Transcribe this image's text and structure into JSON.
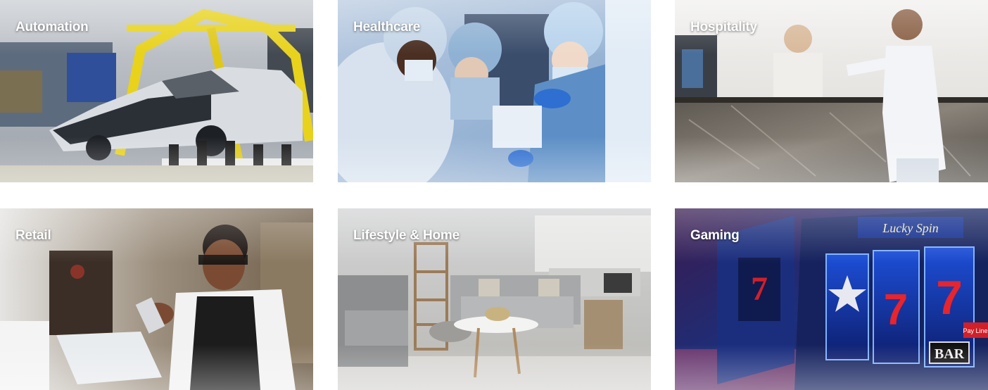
{
  "tiles": {
    "automation": {
      "label": "Automation",
      "image": "car-assembly-line-photo"
    },
    "healthcare": {
      "label": "Healthcare",
      "image": "surgeons-operating-photo"
    },
    "hospitality": {
      "label": "Hospitality",
      "image": "hotel-reception-desk-photo"
    },
    "retail": {
      "label": "Retail",
      "image": "shop-worker-with-tablet-photo"
    },
    "lifestyle": {
      "label": "Lifestyle & Home",
      "image": "living-room-interior-photo"
    },
    "gaming": {
      "label": "Gaming",
      "image": "slot-machine-photo",
      "machine_text": {
        "title": "Lucky Spin",
        "reel_symbol": "7",
        "bar_symbol": "BAR",
        "side_tag": "Pay Line"
      }
    }
  }
}
